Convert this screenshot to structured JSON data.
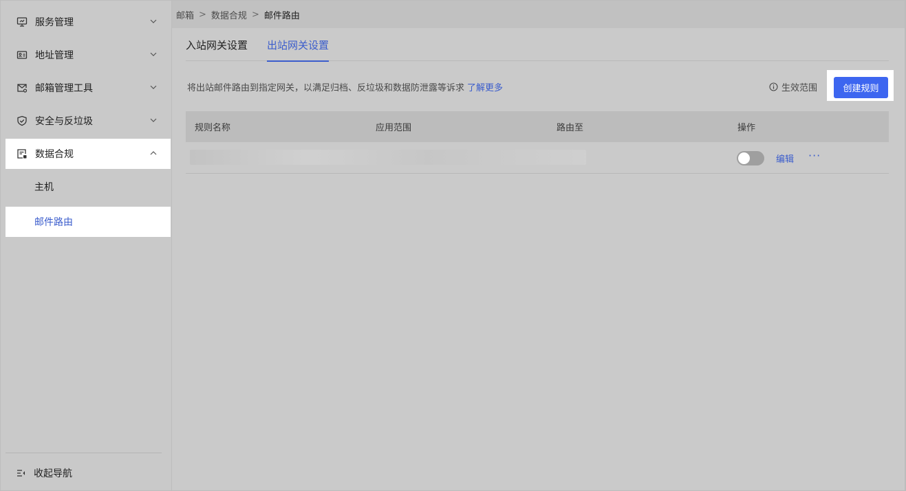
{
  "sidebar": {
    "items": [
      {
        "label": "服务管理",
        "icon": "monitor-icon"
      },
      {
        "label": "地址管理",
        "icon": "id-card-icon"
      },
      {
        "label": "邮箱管理工具",
        "icon": "mail-settings-icon"
      },
      {
        "label": "安全与反垃圾",
        "icon": "shield-check-icon"
      },
      {
        "label": "数据合规",
        "icon": "compliance-doc-icon"
      }
    ],
    "sub_items": [
      {
        "label": "主机"
      },
      {
        "label": "邮件路由"
      }
    ],
    "collapse_label": "收起导航"
  },
  "breadcrumb": {
    "items": [
      "邮箱",
      "数据合规",
      "邮件路由"
    ],
    "separator": ">"
  },
  "tabs": [
    {
      "label": "入站网关设置"
    },
    {
      "label": "出站网关设置"
    }
  ],
  "description": {
    "text": "将出站邮件路由到指定网关，以满足归档、反垃圾和数据防泄露等诉求",
    "link": "了解更多"
  },
  "scope_label": "生效范围",
  "create_button": "创建规则",
  "table": {
    "headers": [
      "规则名称",
      "应用范围",
      "路由至",
      "操作"
    ],
    "rows": [
      {
        "enabled": false,
        "edit_label": "编辑",
        "more_label": "···"
      }
    ]
  },
  "colors": {
    "accent": "#3d66f0",
    "link": "#3a5ccc"
  }
}
